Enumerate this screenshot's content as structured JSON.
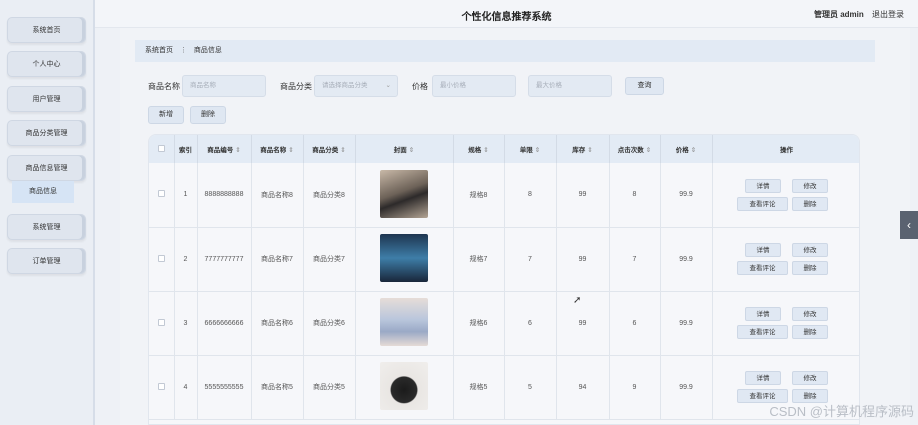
{
  "header": {
    "title": "个性化信息推荐系统",
    "user": "管理员 admin",
    "logout": "退出登录"
  },
  "sidebar": {
    "items": [
      {
        "label": "系统首页"
      },
      {
        "label": "个人中心"
      },
      {
        "label": "用户管理"
      },
      {
        "label": "商品分类管理"
      },
      {
        "label": "商品信息管理"
      },
      {
        "label": "系统管理"
      },
      {
        "label": "订单管理"
      }
    ],
    "sub_item": "商品信息"
  },
  "breadcrumb": {
    "home": "系统首页",
    "separator": "⋮",
    "current": "商品信息"
  },
  "search": {
    "name_label": "商品名称",
    "name_placeholder": "商品名称",
    "category_label": "商品分类",
    "category_placeholder": "请选择商品分类",
    "price_label": "价格",
    "min_price_placeholder": "最小价格",
    "max_price_placeholder": "最大价格",
    "query_button": "查询"
  },
  "toolbar": {
    "add_button": "新增",
    "delete_button": "删除"
  },
  "table": {
    "headers": [
      "索引",
      "商品编号",
      "商品名称",
      "商品分类",
      "封面",
      "规格",
      "单限",
      "库存",
      "点击次数",
      "价格",
      "操作"
    ],
    "rows": [
      {
        "index": "1",
        "code": "8888888888",
        "name": "商品名称8",
        "category": "商品分类8",
        "spec": "规格8",
        "limit": "8",
        "stock": "99",
        "clicks": "8",
        "price": "99.9"
      },
      {
        "index": "2",
        "code": "7777777777",
        "name": "商品名称7",
        "category": "商品分类7",
        "spec": "规格7",
        "limit": "7",
        "stock": "99",
        "clicks": "7",
        "price": "99.9"
      },
      {
        "index": "3",
        "code": "6666666666",
        "name": "商品名称6",
        "category": "商品分类6",
        "spec": "规格6",
        "limit": "6",
        "stock": "99",
        "clicks": "6",
        "price": "99.9"
      },
      {
        "index": "4",
        "code": "5555555555",
        "name": "商品名称5",
        "category": "商品分类5",
        "spec": "规格5",
        "limit": "5",
        "stock": "94",
        "clicks": "9",
        "price": "99.9"
      }
    ],
    "actions": {
      "detail": "详情",
      "edit": "修改",
      "comments": "查看评论",
      "delete": "删除"
    }
  },
  "edge_tab": "‹",
  "watermark": "CSDN @计算机程序源码",
  "colors": {
    "accent": "#dfe7f2",
    "header_bg": "#e3ebf5",
    "sidebar_bg": "#eaeef4"
  }
}
